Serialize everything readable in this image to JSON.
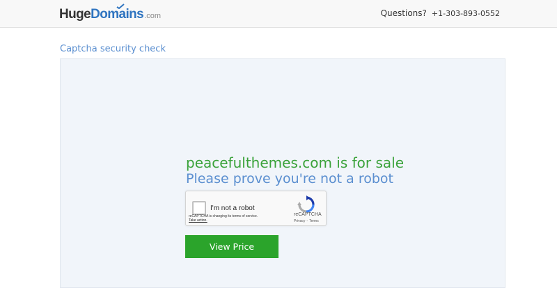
{
  "header": {
    "logo": {
      "brand_main": "Huge",
      "brand_accent": "Domains",
      "tld": ".com"
    },
    "questions_label": "Questions?",
    "phone": "+1-303-893-0552"
  },
  "page": {
    "heading": "Captcha security check",
    "sale_title": "peacefulthemes.com is for sale",
    "prove_text": "Please prove you're not a robot"
  },
  "recaptcha": {
    "checkbox_label": "I'm not a robot",
    "brand": "reCAPTCHA",
    "privacy": "Privacy",
    "terms": "Terms",
    "separator": "-",
    "notice": "reCAPTCHA is changing its terms of service.",
    "notice_link": "Take action."
  },
  "actions": {
    "view_price_label": "View Price"
  },
  "colors": {
    "accent_blue": "#2f74c0",
    "heading_blue": "#5b8fd0",
    "sale_green": "#3aa23a",
    "button_green": "#2ba42b",
    "panel_bg": "#f1f5fa"
  }
}
